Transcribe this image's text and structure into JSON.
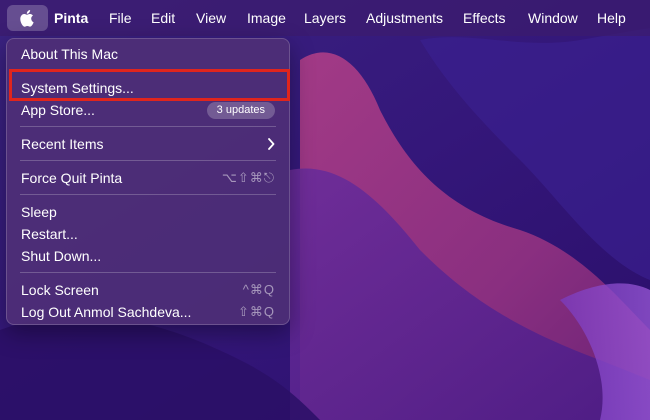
{
  "menubar": {
    "app_name": "Pinta",
    "menus": [
      "File",
      "Edit",
      "View",
      "Image",
      "Layers",
      "Adjustments",
      "Effects",
      "Window",
      "Help"
    ]
  },
  "apple_menu": {
    "about": "About This Mac",
    "system_settings": "System Settings...",
    "app_store": "App Store...",
    "app_store_badge": "3 updates",
    "recent_items": "Recent Items",
    "force_quit": "Force Quit Pinta",
    "force_quit_shortcut": "⌥⇧⌘⎋",
    "sleep": "Sleep",
    "restart": "Restart...",
    "shut_down": "Shut Down...",
    "lock_screen": "Lock Screen",
    "lock_screen_shortcut": "^⌘Q",
    "log_out": "Log Out Anmol Sachdeva...",
    "log_out_shortcut": "⇧⌘Q"
  },
  "colors": {
    "highlight_border": "#e0251d",
    "desktop_base": "#3a1d7a"
  },
  "icons": {
    "apple": "apple-logo-icon",
    "submenu": "chevron-right-icon"
  }
}
